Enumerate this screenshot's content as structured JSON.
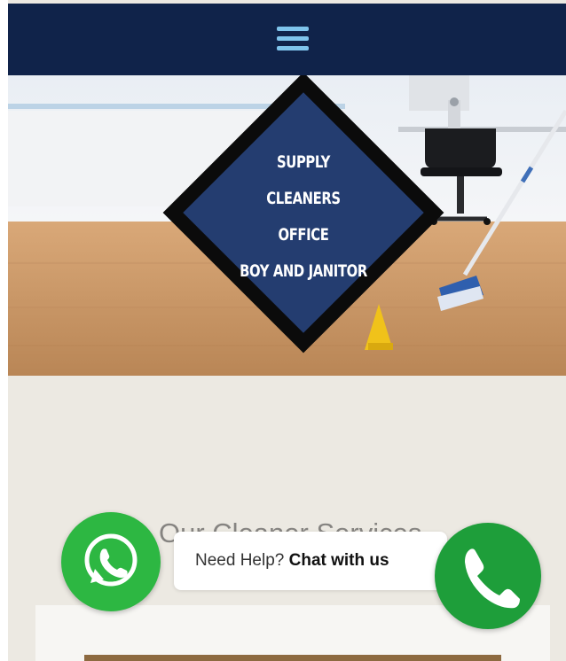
{
  "header": {
    "menu_icon": "hamburger-menu-icon",
    "background": "#10234a",
    "icon_color": "#7fc4ec"
  },
  "hero": {
    "badge_lines": [
      "SUPPLY",
      "CLEANERS",
      "OFFICE",
      "BOY AND JANITOR"
    ],
    "badge_fill": "#243d70",
    "badge_border": "#0b0b0b"
  },
  "section": {
    "heading": "Our Cleaner Services"
  },
  "chat_widget": {
    "prompt": "Need Help?",
    "action": "Chat with us",
    "whatsapp_icon": "whatsapp-icon",
    "phone_icon": "phone-icon",
    "whatsapp_color": "#2db742",
    "phone_color": "#1e9e3a"
  }
}
